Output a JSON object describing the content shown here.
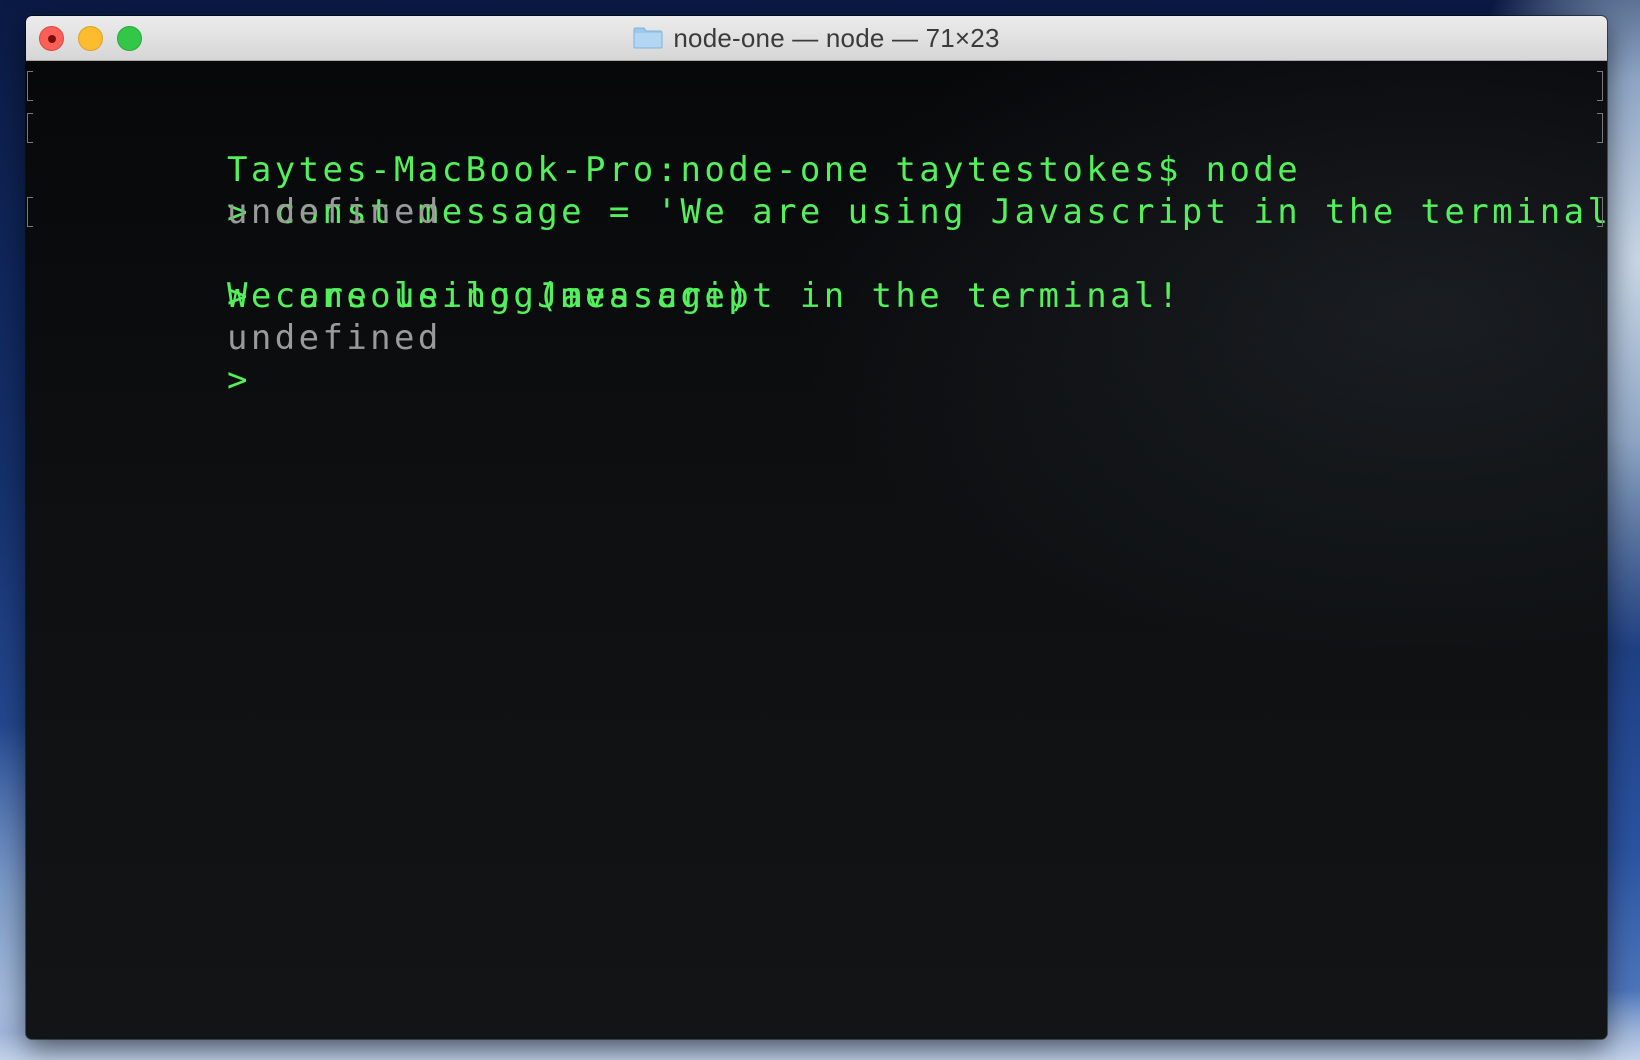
{
  "window": {
    "title": "node-one — node — 71×23",
    "folder_icon": "folder-icon"
  },
  "terminal": {
    "lines": [
      {
        "text": "Taytes-MacBook-Pro:node-one taytestokes$ node",
        "color": "#52f05a",
        "marked": true
      },
      {
        "text": "> const message = 'We are using Javascript in the terminal!'",
        "color": "#52f05a",
        "marked": true
      },
      {
        "text": "undefined",
        "color": "#9a9a9a",
        "marked": false
      },
      {
        "text": "> console.log(message)",
        "color": "#52f05a",
        "marked": true
      },
      {
        "text": "We are using Javascript in the terminal!",
        "color": "#52f05a",
        "marked": false
      },
      {
        "text": "undefined",
        "color": "#9a9a9a",
        "marked": false
      },
      {
        "text": ">",
        "color": "#52f05a",
        "marked": false
      }
    ]
  },
  "colors": {
    "terminal_text_green": "#52f05a",
    "terminal_text_gray": "#9a9a9a",
    "terminal_background": "#0c0d0f"
  }
}
